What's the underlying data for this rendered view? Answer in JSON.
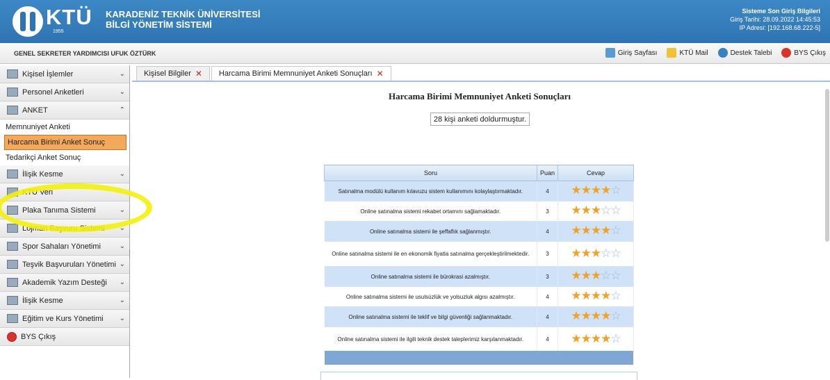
{
  "header": {
    "logo": "KTÜ",
    "logo_year": "1955",
    "uni_line1": "KARADENİZ TEKNİK ÜNİVERSİTESİ",
    "uni_line2": "BİLGİ YÖNETİM SİSTEMİ",
    "login_title": "Sisteme Son Giriş Bilgileri",
    "login_date": "Giriş Tarihi: 28.09.2022 14:45:53",
    "login_ip": "IP Adresi: [192.168.68.222-5]"
  },
  "subbar": {
    "user": "GENEL SEKRETER YARDIMCISI UFUK ÖZTÜRK",
    "links": [
      "Giriş Sayfası",
      "KTÜ Mail",
      "Destek Talebi",
      "BYS Çıkış"
    ]
  },
  "sidebar": {
    "items": [
      {
        "label": "Kişisel İşlemler"
      },
      {
        "label": "Personel Anketleri"
      },
      {
        "label": "ANKET"
      }
    ],
    "anket_sub": [
      "Memnuniyet Anketi",
      "Harcama Birimi Anket Sonuç",
      "Tedarikçi Anket Sonuç"
    ],
    "items2": [
      {
        "label": "İlişik Kesme"
      },
      {
        "label": "KTÜ Veri"
      },
      {
        "label": "Plaka Tanıma Sistemi"
      },
      {
        "label": "Lojman Başvuru Sistemi"
      },
      {
        "label": "Spor Sahaları Yönetimi"
      },
      {
        "label": "Teşvik Başvuruları Yönetimi"
      },
      {
        "label": "Akademik Yazım Desteği"
      },
      {
        "label": "İlişik Kesme"
      },
      {
        "label": "Eğitim ve Kurs Yönetimi"
      },
      {
        "label": "BYS Çıkış"
      }
    ]
  },
  "tabs": [
    "Kişisel Bilgiler",
    "Harcama Birimi Memnuniyet Anketi Sonuçları"
  ],
  "content": {
    "title": "Harcama Birimi Memnuniyet Anketi Sonuçları",
    "count": "28 kişi anketi doldurmuştur.",
    "columns": [
      "Soru",
      "Puan",
      "Cevap"
    ],
    "rows": [
      {
        "q": "Satınalma modülü kullanım kılavuzu sistem kullanımını kolaylaştırmaktadır.",
        "p": "4"
      },
      {
        "q": "Online satınalma sistemi rekabet ortamını sağlamaktadır.",
        "p": "3"
      },
      {
        "q": "Online satınalma sistemi ile şeffaflık sağlanmıştır.",
        "p": "4"
      },
      {
        "q": "Online satınalma sistemi ile en ekonomik fiyatla satınalma gerçekleştirilmektedir.",
        "p": "3"
      },
      {
        "q": "Online satınalma sistemi ile bürokrasi azalmıştır.",
        "p": "3"
      },
      {
        "q": "Online satınalma sistemi ile usulsüzlük ve yolsuzluk algısı azalmıştır.",
        "p": "4"
      },
      {
        "q": "Online satınalma sistemi ile teklif ve bilgi güvenliği sağlanmaktadır.",
        "p": "4"
      },
      {
        "q": "Online satınalma sistemi ile ilgili teknik destek taleplerimiz karşılanmaktadır.",
        "p": "4"
      }
    ]
  }
}
